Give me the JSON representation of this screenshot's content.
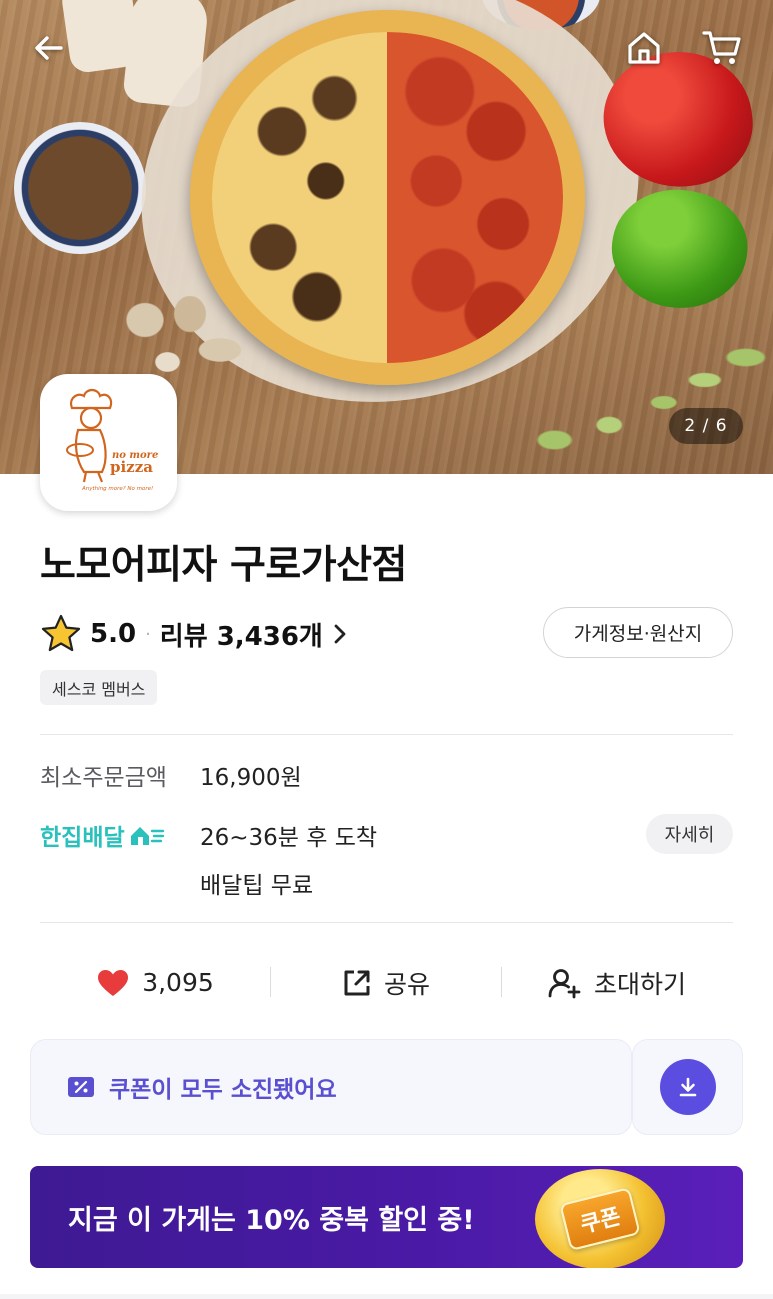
{
  "hero": {
    "page_counter": "2 / 6",
    "icons": {
      "back": "arrow-left-icon",
      "home": "home-icon",
      "cart": "cart-icon"
    }
  },
  "store": {
    "logo_text_top": "no more",
    "logo_text_main": "pizza",
    "logo_tagline": "Anything more? No more!",
    "name": "노모어피자 구로가산점",
    "rating": "5.0",
    "dot": "·",
    "review_label": "리뷰 3,436개",
    "info_button": "가게정보·원산지",
    "member_badge": "세스코 멤버스"
  },
  "order_info": {
    "min_order_label": "최소주문금액",
    "min_order_value": "16,900원",
    "delivery_brand": "한집배달",
    "delivery_time": "26~36분 후 도착",
    "delivery_tip": "배달팁 무료",
    "detail_button": "자세히"
  },
  "actions": {
    "likes": "3,095",
    "share": "공유",
    "invite": "초대하기"
  },
  "coupon": {
    "text": "쿠폰이 모두 소진됐어요"
  },
  "promo": {
    "text": "지금 이 가게는 10% 중복 할인 중!",
    "coin_label": "쿠폰"
  },
  "colors": {
    "accent_mint": "#2ac1bc",
    "coupon_purple": "#5a4fd1",
    "promo_bg": "#4a1aa6",
    "heart_red": "#e83b3b",
    "star_yellow": "#f7c531"
  }
}
